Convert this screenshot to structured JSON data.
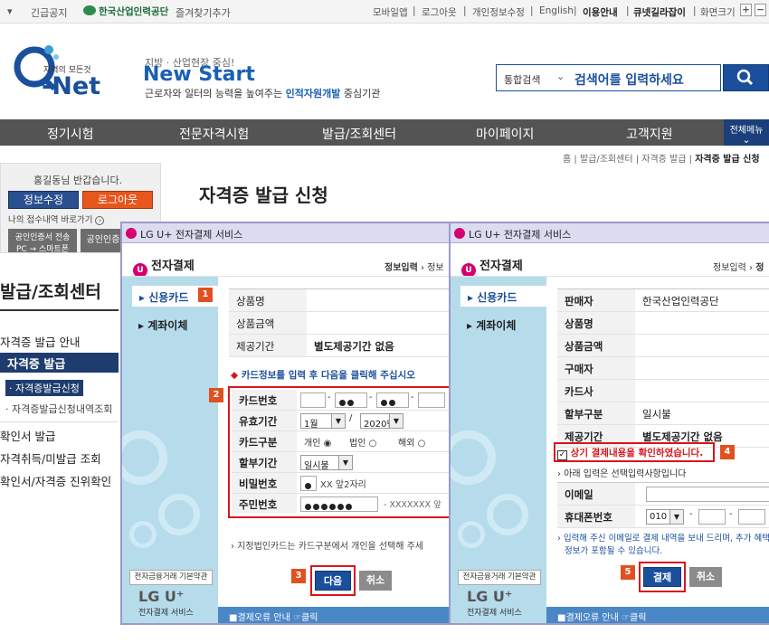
{
  "topbar": {
    "emergency": "긴급공지",
    "org": "한국산업인력공단",
    "favorite": "즐겨찾기추가",
    "links": [
      "모바일앱",
      "로그아웃",
      "개인정보수정",
      "English",
      "이용안내",
      "큐넷길라잡이"
    ],
    "zoom_label": "화면크기",
    "zoom_in": "+",
    "zoom_out": "−"
  },
  "logo": {
    "small": "자격의 모든것",
    "name": "Net"
  },
  "slogan": {
    "sub": "지방 · 산업현장 중심!",
    "title": "New Start",
    "desc_pre": "근로자와 일터의 능력을 높여주는 ",
    "desc_strong": "인적자원개발",
    "desc_post": " 중심기관"
  },
  "search": {
    "category": "통합검색",
    "placeholder": "검색어를 입력하세요"
  },
  "gnb": [
    "정기시험",
    "전문자격시험",
    "발급/조회센터",
    "마이페이지",
    "고객지원"
  ],
  "gnb_all": "전체메뉴",
  "login": {
    "greeting": "홍길동님 반갑습니다.",
    "edit": "정보수정",
    "logout": "로그아웃",
    "recent": "나의 접수내역 바로가기",
    "cert1": "공인인증서 전송",
    "cert1b": "PC → 스마트폰",
    "cert2": "공인인증"
  },
  "side": {
    "title": "발급/조회센터",
    "items": [
      "자격증 발급 안내",
      "자격증 발급",
      "자격증발급신청",
      "자격증발급신청내역조회",
      "확인서 발급",
      "자격취득/미발급 조회",
      "확인서/자격증 진위확인"
    ]
  },
  "breadcrumb": {
    "home": "홈",
    "sep": "|",
    "c1": "발급/조회센터",
    "c2": "자격증 발급",
    "current": "자격증 발급 신청"
  },
  "page_title": "자격증 발급 신청",
  "dialog1": {
    "title": "LG U+ 전자결제 서비스",
    "brand": "전자결제",
    "brand_icon": "U",
    "step1": "정보입력",
    "step_arrow": "›",
    "step2": "정보",
    "tab_card": "신용카드",
    "tab_transfer": "계좌이체",
    "rows": [
      {
        "label": "상품명",
        "value": ""
      },
      {
        "label": "상품금액",
        "value": ""
      },
      {
        "label": "제공기간",
        "value": "별도제공기간 없음"
      }
    ],
    "notice": "카드정보를 입력 후 다음을 클릭해 주십시오",
    "card_label": "카드번호",
    "expiry_label": "유효기간",
    "month": "1월",
    "year": "2020년",
    "slash": "/",
    "dash": "-",
    "type_label": "카드구분",
    "type_personal": "개인",
    "type_corp": "법인",
    "type_foreign": "해외",
    "install_label": "할부기간",
    "install_value": "일시불",
    "pw_label": "비밀번호",
    "pw_hint": "XX 앞2자리",
    "id_label": "주민번호",
    "id_hint": "- XXXXXXX 앞",
    "corp_note": "지정법인카드는 카드구분에서 개인을 선택해 주세",
    "next": "다음",
    "cancel": "취소",
    "terms": "전자금융거래 기본약관",
    "lgu": "LG U⁺",
    "lgu_sub": "전자결제 서비스",
    "error_link": "결제오류 안내",
    "click": "클릭",
    "badges": [
      "1",
      "2",
      "3"
    ]
  },
  "dialog2": {
    "title": "LG U+ 전자결제 서비스",
    "brand": "전자결제",
    "brand_icon": "U",
    "step1": "정보입력",
    "step_arrow": "›",
    "step2": "정",
    "tab_card": "신용카드",
    "tab_transfer": "계좌이체",
    "rows": [
      {
        "label": "판매자",
        "value": "한국산업인력공단"
      },
      {
        "label": "상품명",
        "value": ""
      },
      {
        "label": "상품금액",
        "value": ""
      },
      {
        "label": "구매자",
        "value": ""
      },
      {
        "label": "카드사",
        "value": ""
      },
      {
        "label": "할부구분",
        "value": "일시불"
      },
      {
        "label": "제공기간",
        "value": "별도제공기간 없음"
      }
    ],
    "confirm": "상기 결제내용을 확인하였습니다.",
    "optional": "아래 입력은 선택입력사항입니다",
    "email_label": "이메일",
    "phone_label": "휴대폰번호",
    "phone_prefix": "010",
    "dash": "-",
    "email_note1": "입력해 주신 이메일로 결제 내역을 보내 드리며, 추가 혜택",
    "email_note2": "정보가 포함될 수 있습니다.",
    "pay": "결제",
    "cancel": "취소",
    "terms": "전자금융거래 기본약관",
    "lgu": "LG U⁺",
    "lgu_sub": "전자결제 서비스",
    "error_link": "결제오류 안내",
    "click": "클릭",
    "badges": [
      "4",
      "5"
    ]
  },
  "colors": {
    "brand": "#1a4f9c",
    "highlight": "#d9151c",
    "badge": "#e0511f",
    "lgu": "#d6006e"
  }
}
